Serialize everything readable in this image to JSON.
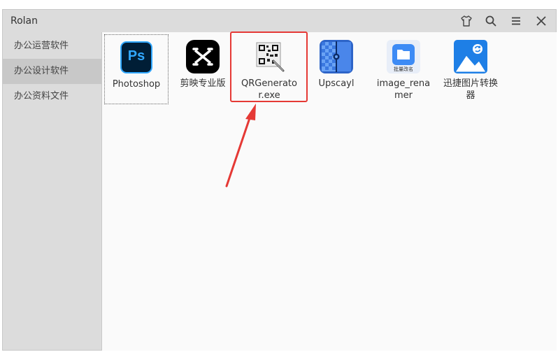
{
  "window": {
    "title": "Rolan"
  },
  "titlebar_icons": [
    "shirt-skin-icon",
    "search-icon",
    "menu-icon",
    "close-icon"
  ],
  "sidebar": {
    "items": [
      {
        "label": "办公运营软件",
        "active": false
      },
      {
        "label": "办公设计软件",
        "active": true
      },
      {
        "label": "办公资料文件",
        "active": false
      }
    ]
  },
  "apps": [
    {
      "label": "Photoshop",
      "icon": "photoshop-icon",
      "icon_text": "Ps"
    },
    {
      "label": "剪映专业版",
      "icon": "capcut-icon"
    },
    {
      "label": "QRGenerator.exe",
      "icon": "qr-generator-icon"
    },
    {
      "label": "Upscayl",
      "icon": "upscayl-icon"
    },
    {
      "label": "image_renamer",
      "icon": "image-renamer-icon",
      "icon_text": "批量改名"
    },
    {
      "label": "迅捷图片转换器",
      "icon": "image-converter-icon"
    }
  ],
  "colors": {
    "annotation": "#e53935",
    "ps_bg": "#001e36",
    "ps_accent": "#31a8ff"
  }
}
